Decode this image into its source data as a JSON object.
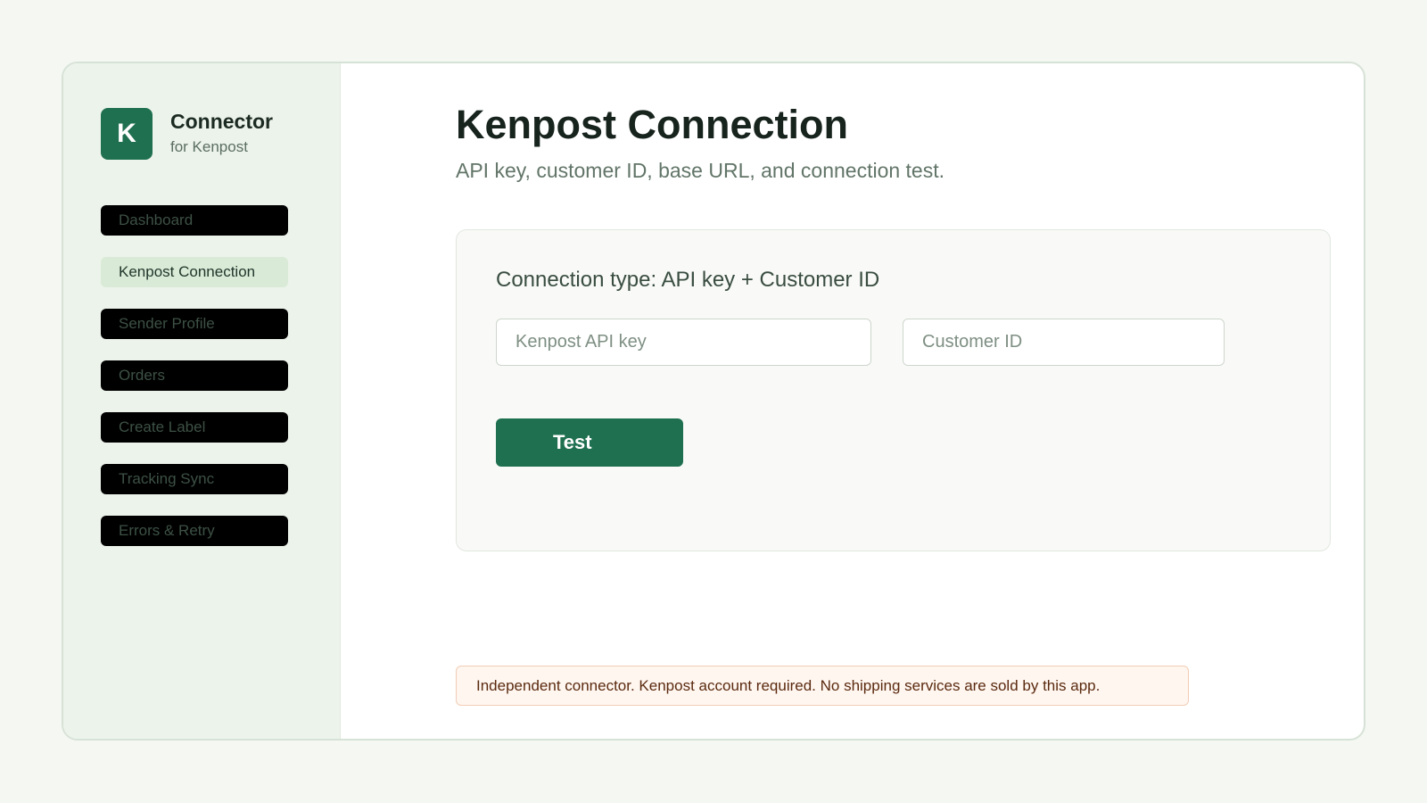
{
  "brand": {
    "logo_letter": "K",
    "name": "Connector",
    "subtitle": "for Kenpost"
  },
  "sidebar": {
    "items": [
      {
        "label": "Dashboard",
        "active": false
      },
      {
        "label": "Kenpost Connection",
        "active": true
      },
      {
        "label": "Sender Profile",
        "active": false
      },
      {
        "label": "Orders",
        "active": false
      },
      {
        "label": "Create Label",
        "active": false
      },
      {
        "label": "Tracking Sync",
        "active": false
      },
      {
        "label": "Errors & Retry",
        "active": false
      }
    ]
  },
  "main": {
    "title": "Kenpost Connection",
    "subtitle": "API key, customer ID, base URL, and connection test.",
    "card": {
      "connection_type": "Connection type: API key + Customer ID",
      "api_key": {
        "value": "",
        "placeholder": "Kenpost API key"
      },
      "customer_id": {
        "value": "",
        "placeholder": "Customer ID"
      },
      "test_label": "Test"
    },
    "notice": "Independent connector. Kenpost account required. No shipping services are sold by this app."
  },
  "colors": {
    "accent": "#1f7050",
    "sidebar_bg": "#ecf3ea",
    "active_item_bg": "#d9ead7",
    "notice_bg": "#fff6f0",
    "notice_border": "#f1cdb6"
  }
}
